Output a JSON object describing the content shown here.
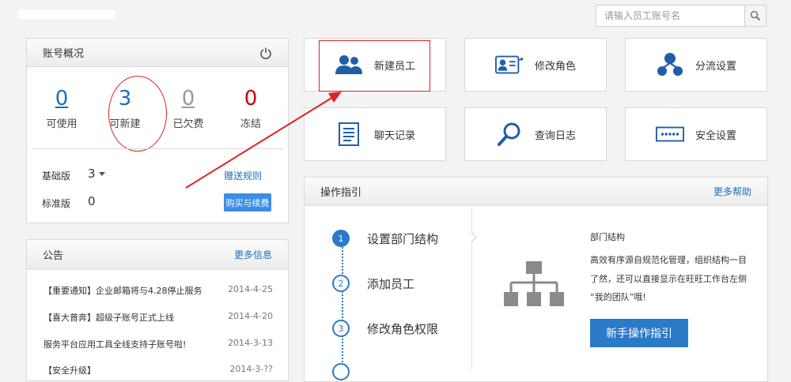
{
  "search": {
    "placeholder": "请输入员工账号名"
  },
  "account": {
    "title": "账号概况",
    "stats": [
      {
        "value": "0",
        "label": "可使用",
        "color": "#1a6fc0"
      },
      {
        "value": "3",
        "label": "可新建",
        "color": "#1a6fc0"
      },
      {
        "value": "0",
        "label": "已欠费",
        "color": "#999999"
      },
      {
        "value": "0",
        "label": "冻结",
        "color": "#cc0000"
      }
    ],
    "basic_label": "基础版",
    "basic_value": "3",
    "gift_rule": "赠送规则",
    "standard_label": "标准版",
    "standard_value": "0",
    "buy_button": "购买与续费"
  },
  "notices": {
    "title": "公告",
    "more": "更多信息",
    "items": [
      {
        "text": "【重要通知】企业邮箱将与4.28停止服务",
        "date": "2014-4-25"
      },
      {
        "text": "【喜大普奔】超级子账号正式上线",
        "date": "2014-4-20"
      },
      {
        "text": "服务平台应用工具全线支持子账号啦!",
        "date": "2014-3-13"
      },
      {
        "text": "【安全升级】",
        "date": "2014-3-??"
      }
    ]
  },
  "tiles": [
    {
      "label": "新建员工",
      "icon": "users-icon"
    },
    {
      "label": "修改角色",
      "icon": "id-card-icon"
    },
    {
      "label": "分流设置",
      "icon": "distribution-icon"
    },
    {
      "label": "聊天记录",
      "icon": "document-icon"
    },
    {
      "label": "查询日志",
      "icon": "magnifier-icon"
    },
    {
      "label": "安全设置",
      "icon": "password-icon"
    }
  ],
  "guide": {
    "title": "操作指引",
    "more": "更多帮助",
    "steps": [
      {
        "num": "1",
        "label": "设置部门结构"
      },
      {
        "num": "2",
        "label": "添加员工"
      },
      {
        "num": "3",
        "label": "修改角色权限"
      }
    ],
    "detail_title": "部门结构",
    "detail_text_1": "高效有序源自规范化管理，组织结构一目",
    "detail_text_2": "了然，还可以直接显示在旺旺工作台左侧",
    "detail_text_3": "“我的团队”哦!",
    "novice_button": "新手操作指引"
  },
  "colors": {
    "accent": "#2b7ac7",
    "highlight_red": "#e02020"
  }
}
